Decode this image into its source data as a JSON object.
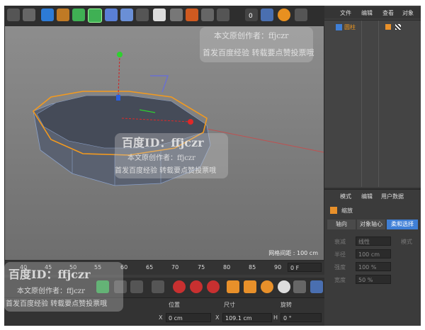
{
  "right_menu": {
    "file": "文件",
    "edit": "编辑",
    "view": "查看",
    "object": "对象"
  },
  "object_list": {
    "item_name": "圆柱"
  },
  "attributes": {
    "menu": {
      "mode": "模式",
      "edit": "编辑",
      "userdata": "用户数据"
    },
    "title": "缩放",
    "tabs": {
      "axis": "轴向",
      "object_axis": "对象轴心",
      "soft_select": "柔和选择"
    },
    "mode_label": "模式",
    "falloff_label": "衰减",
    "falloff_value": "线性",
    "radius_label": "半径",
    "radius_value": "100 cm",
    "strength_label": "强度",
    "strength_value": "100 %",
    "width_label": "宽度",
    "width_value": "50 %"
  },
  "viewport": {
    "grid_spacing": "网格间距 : 100 cm"
  },
  "timeline": {
    "ticks": [
      "40",
      "45",
      "50",
      "55",
      "60",
      "65",
      "70",
      "75",
      "80",
      "85",
      "90"
    ],
    "frame_field": "0 F"
  },
  "coordinates": {
    "position_header": "位置",
    "size_header": "尺寸",
    "rotation_header": "旋转",
    "x_label": "X",
    "x_position": "0 cm",
    "x_size_label": "X",
    "x_size": "109.1 cm",
    "h_label": "H",
    "h_rotation": "0 °"
  },
  "toolbar": {
    "render_badge": "0"
  },
  "watermarks": {
    "id_text": "百度ID：ffjczr",
    "author": "本文原创作者：ffjczr",
    "notice": "首发百度经验 转载要点赞投票哦"
  },
  "colors": {
    "accent": "#f39a1e",
    "selection": "#3f7fd6",
    "panel_bg": "#3a3a3a"
  }
}
